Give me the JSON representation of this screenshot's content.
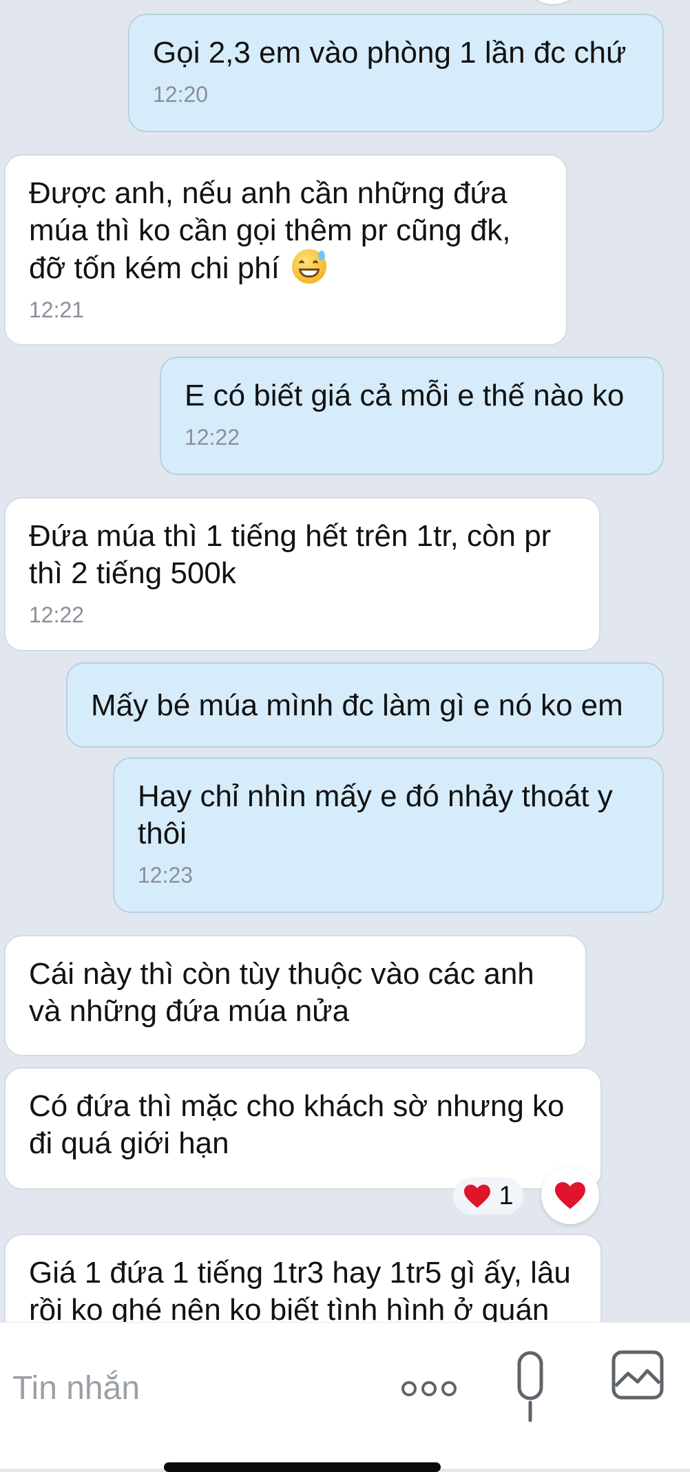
{
  "messages": [
    {
      "direction": "out",
      "text": "Gọi 2,3 em vào phòng 1 lần đc chứ",
      "time": "12:20"
    },
    {
      "direction": "in",
      "text": "Được anh, nếu anh cần những đứa múa thì ko cần gọi thêm pr cũng đk, đỡ tốn kém chi phí",
      "time": "12:21",
      "emoji": "grinning-sweat-emoji"
    },
    {
      "direction": "out",
      "text": "E có biết giá cả mỗi e thế nào ko",
      "time": "12:22"
    },
    {
      "direction": "in",
      "text": "Đứa múa thì 1 tiếng hết trên 1tr, còn pr thì 2 tiếng 500k",
      "time": "12:22"
    },
    {
      "direction": "out",
      "text": "Mấy bé múa mình đc làm gì e nó ko em"
    },
    {
      "direction": "out",
      "text": "Hay chỉ nhìn mấy e đó nhảy thoát y thôi",
      "time": "12:23"
    },
    {
      "direction": "in",
      "text": "Cái này thì còn tùy thuộc vào các anh và những đứa múa nửa"
    },
    {
      "direction": "in",
      "text": "Có đứa thì mặc cho khách sờ nhưng ko đi quá giới hạn",
      "reaction": {
        "icon": "heart-icon",
        "count": "1"
      }
    },
    {
      "direction": "in",
      "text": "Giá 1 đứa 1 tiếng 1tr3 hay 1tr5 gì ấy, lâu rồi ko ghé nên ko biết tình hình ở quán"
    }
  ],
  "composer": {
    "placeholder": "Tin nhắn",
    "icons": [
      "more-icon",
      "microphone-icon",
      "image-icon"
    ]
  },
  "colors": {
    "background": "#e2e7ef",
    "incoming_bubble": "#ffffff",
    "outgoing_bubble": "#d6ecfa",
    "reaction_heart": "#e0142b"
  }
}
